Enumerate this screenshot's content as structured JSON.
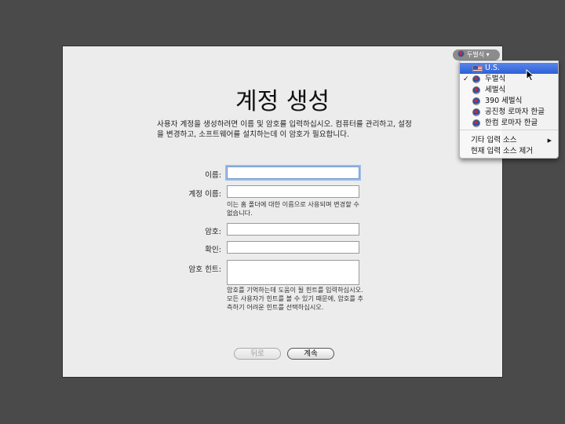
{
  "window": {
    "title": "계정 생성",
    "description": "사용자 계정을 생성하려면 이름 및 암호를 입력하십시오. 컴퓨터를 관리하고, 설정을 변경하고, 소프트웨어를 설치하는데 이 암호가 필요합니다."
  },
  "form": {
    "name_label": "이름:",
    "name_value": "",
    "account_label": "계정 이름:",
    "account_value": "",
    "account_note": "이는 홈 폴더에 대한 이름으로 사용되며 변경할 수 없습니다.",
    "password_label": "암호:",
    "password_value": "",
    "verify_label": "확인:",
    "verify_value": "",
    "hint_label": "암호 힌트:",
    "hint_value": "",
    "hint_note": "암호를 기억하는데 도움이 될 힌트를 입력하십시오. 모든 사용자가 힌트를 볼 수 있기 때문에, 암호를 추측하기 어려운 힌트를 선택하십시오."
  },
  "buttons": {
    "back_label": "뒤로",
    "continue_label": "계속"
  },
  "input_menu": {
    "current_label": "두벌식 ▾",
    "items": [
      {
        "label": "U.S.",
        "flag": "us-flag-icon",
        "selected": true,
        "checked": false
      },
      {
        "label": "두벌식",
        "flag": "kr-flag-icon",
        "selected": false,
        "checked": true
      },
      {
        "label": "세벌식",
        "flag": "kr-flag-icon",
        "selected": false,
        "checked": false
      },
      {
        "label": "390 세벌식",
        "flag": "kr-flag-icon",
        "selected": false,
        "checked": false
      },
      {
        "label": "공진청 로마자 한글",
        "flag": "kr-flag-icon",
        "selected": false,
        "checked": false
      },
      {
        "label": "한컴 로마자 한글",
        "flag": "kr-flag-icon",
        "selected": false,
        "checked": false
      }
    ],
    "other_sources_label": "기타 입력 소스",
    "remove_source_label": "현재 입력 소스 제거",
    "check_mark": "✓",
    "submenu_arrow": "▶"
  }
}
